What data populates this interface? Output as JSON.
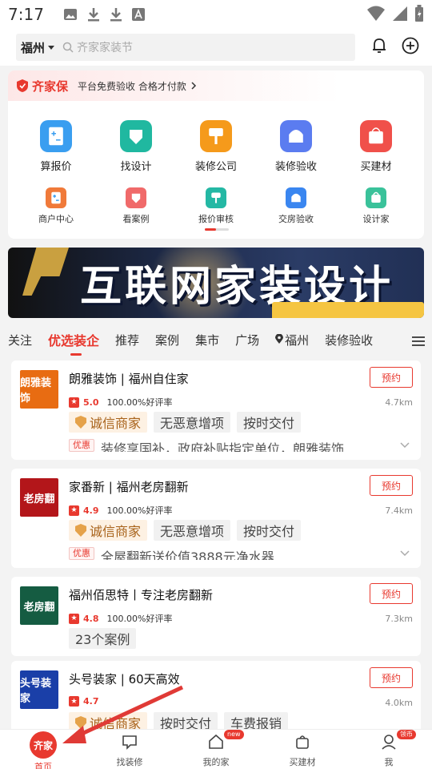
{
  "status_bar": {
    "time": "7:17"
  },
  "header": {
    "city": "福州",
    "search_placeholder": "齐家家装节"
  },
  "guarantee": {
    "brand": "齐家保",
    "note": "平台免费验收 合格才付款"
  },
  "quick_menu_row1": [
    {
      "label": "算报价",
      "color": "#3a9ef0"
    },
    {
      "label": "找设计",
      "color": "#20b8a0"
    },
    {
      "label": "装修公司",
      "color": "#f59a1b"
    },
    {
      "label": "装修验收",
      "color": "#5b7cf0"
    },
    {
      "label": "买建材",
      "color": "#f0504a"
    }
  ],
  "quick_menu_row2": [
    {
      "label": "商户中心",
      "color": "#f07a3a"
    },
    {
      "label": "看案例",
      "color": "#f06a6a"
    },
    {
      "label": "报价审核",
      "color": "#24b8a4"
    },
    {
      "label": "交房验收",
      "color": "#3a86f0"
    },
    {
      "label": "设计家",
      "color": "#3ac29a"
    }
  ],
  "ad_banner": {
    "text": "互联网家装设计"
  },
  "tabs": [
    "关注",
    "优选装企",
    "推荐",
    "案例",
    "集市",
    "广场",
    "福州",
    "装修验收"
  ],
  "active_tab": "优选装企",
  "stores": [
    {
      "name": "朗雅装饰 | 福州自住家",
      "thumb_text": "朗雅装饰",
      "thumb_color": "#e86c12",
      "rating": "5.0",
      "good_rate": "100.00%好评率",
      "distance": "4.7km",
      "certified": "诚信商家",
      "tags": [
        "无恶意增项",
        "按时交付"
      ],
      "promo_label": "优惠",
      "promo": "装修享国补，政府补贴指定单位，朗雅装饰",
      "book": "预约"
    },
    {
      "name": "家番新 | 福州老房翻新",
      "thumb_text": "老房翻",
      "thumb_color": "#b3161a",
      "rating": "4.9",
      "good_rate": "100.00%好评率",
      "distance": "7.4km",
      "certified": "诚信商家",
      "tags": [
        "无恶意增项",
        "按时交付"
      ],
      "promo_label": "优惠",
      "promo": "全屋翻新送价值3888元净水器",
      "book": "预约"
    },
    {
      "name": "福州佰思特丨专注老房翻新",
      "thumb_text": "老房翻",
      "thumb_color": "#155c42",
      "rating": "4.8",
      "good_rate": "100.00%好评率",
      "distance": "7.3km",
      "tags": [
        "23个案例"
      ],
      "book": "预约"
    },
    {
      "name": "头号装家 | 60天高效",
      "thumb_text": "头号装家",
      "thumb_color": "#1a3fa8",
      "rating": "4.7",
      "distance": "4.0km",
      "certified": "诚信商家",
      "tags": [
        "按时交付",
        "车费报销"
      ],
      "book": "预约"
    }
  ],
  "bottom_nav": [
    {
      "label": "首页",
      "icon_text": "齐家",
      "active": true
    },
    {
      "label": "找装修"
    },
    {
      "label": "我的家",
      "badge": "new"
    },
    {
      "label": "买建材"
    },
    {
      "label": "我",
      "badge": "领币"
    }
  ],
  "colors": {
    "accent": "#e8392f",
    "annotation_arrow": "#e03a36"
  }
}
